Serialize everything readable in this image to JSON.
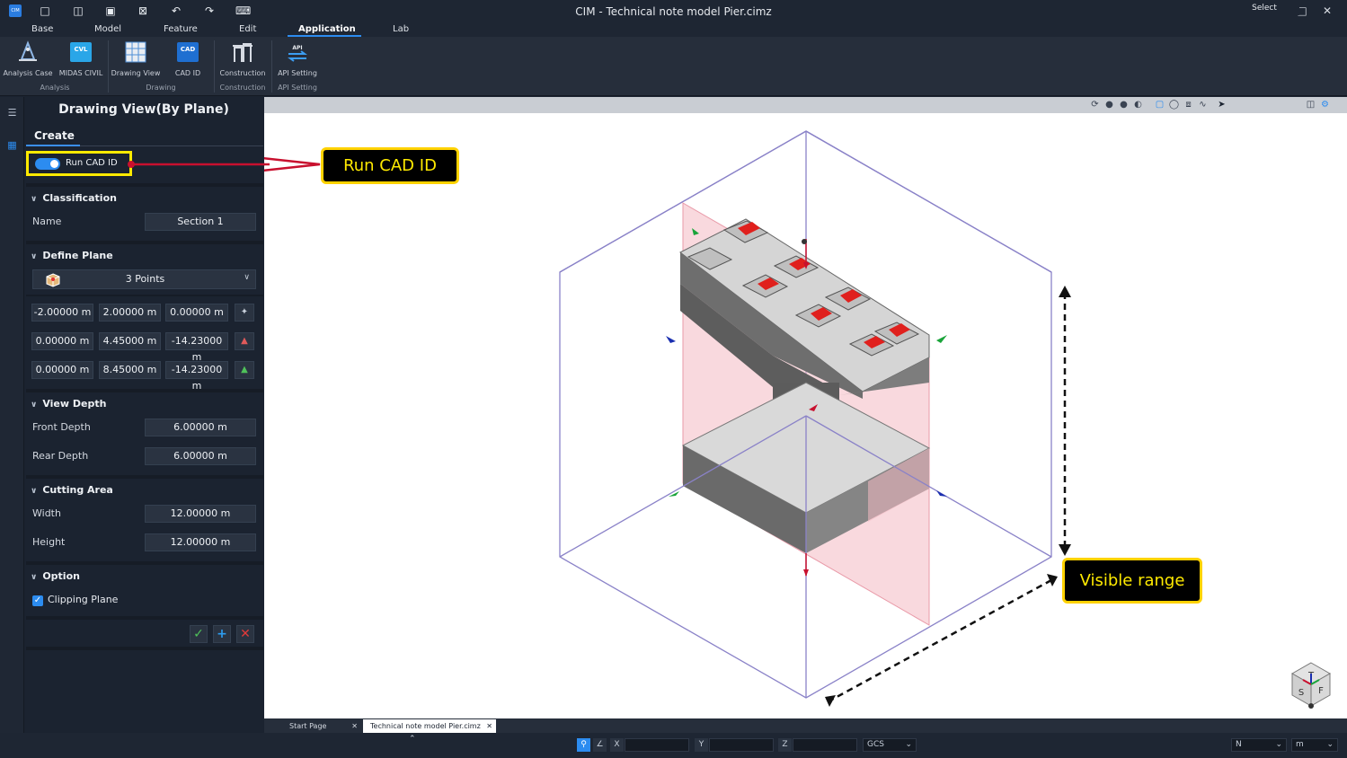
{
  "window": {
    "title": "CIM - Technical note model Pier.cimz",
    "logo_text": "CIM"
  },
  "menu": {
    "items": [
      "Base",
      "Model",
      "Feature",
      "Edit",
      "Application",
      "Lab"
    ],
    "active": "Application"
  },
  "ribbon": {
    "buttons": [
      {
        "label": "Analysis Case",
        "icon": "analysis-case-icon"
      },
      {
        "label": "MIDAS CIVIL",
        "icon": "midas-civil-icon",
        "badge": "CVL"
      },
      {
        "label": "Drawing View",
        "icon": "drawing-view-icon"
      },
      {
        "label": "CAD ID",
        "icon": "cad-id-icon",
        "badge": "CAD"
      },
      {
        "label": "Construction",
        "icon": "construction-icon"
      },
      {
        "label": "API Setting",
        "icon": "api-setting-icon",
        "badge": "API"
      }
    ],
    "groups": [
      "Analysis",
      "Drawing",
      "Construction",
      "API Setting"
    ]
  },
  "panel": {
    "title": "Drawing View(By Plane)",
    "tab": "Create",
    "run_cad_id": {
      "label": "Run CAD ID",
      "enabled": true
    },
    "classification": {
      "header": "Classification",
      "name_label": "Name",
      "name_value": "Section 1"
    },
    "define_plane": {
      "header": "Define Plane",
      "method": "3 Points",
      "points": [
        [
          "-2.00000 m",
          "2.00000 m",
          "0.00000 m"
        ],
        [
          "0.00000 m",
          "4.45000 m",
          "-14.23000 m"
        ],
        [
          "0.00000 m",
          "8.45000 m",
          "-14.23000 m"
        ]
      ]
    },
    "view_depth": {
      "header": "View Depth",
      "front_label": "Front Depth",
      "front_value": "6.00000 m",
      "rear_label": "Rear Depth",
      "rear_value": "6.00000 m"
    },
    "cutting_area": {
      "header": "Cutting Area",
      "width_label": "Width",
      "width_value": "12.00000 m",
      "height_label": "Height",
      "height_value": "12.00000 m"
    },
    "option": {
      "header": "Option",
      "clipping_label": "Clipping Plane",
      "clipping_checked": true
    }
  },
  "view_toolbar": {
    "select_label": "Select"
  },
  "doc_tabs": [
    {
      "label": "Start Page",
      "active": false
    },
    {
      "label": "Technical note model Pier.cimz",
      "active": true
    }
  ],
  "statusbar": {
    "x_label": "X",
    "y_label": "Y",
    "z_label": "Z",
    "coord_system": "GCS",
    "force_unit": "N",
    "length_unit": "m"
  },
  "annotations": {
    "run_cad_id": "Run CAD ID",
    "visible_range": "Visible range"
  },
  "navcube": {
    "top": "T",
    "left": "S",
    "right": "F"
  },
  "colors": {
    "accent": "#2c8cf0",
    "callout_border": "#ffd200",
    "callout_text": "#ffea00",
    "arrow": "#c8102e"
  }
}
